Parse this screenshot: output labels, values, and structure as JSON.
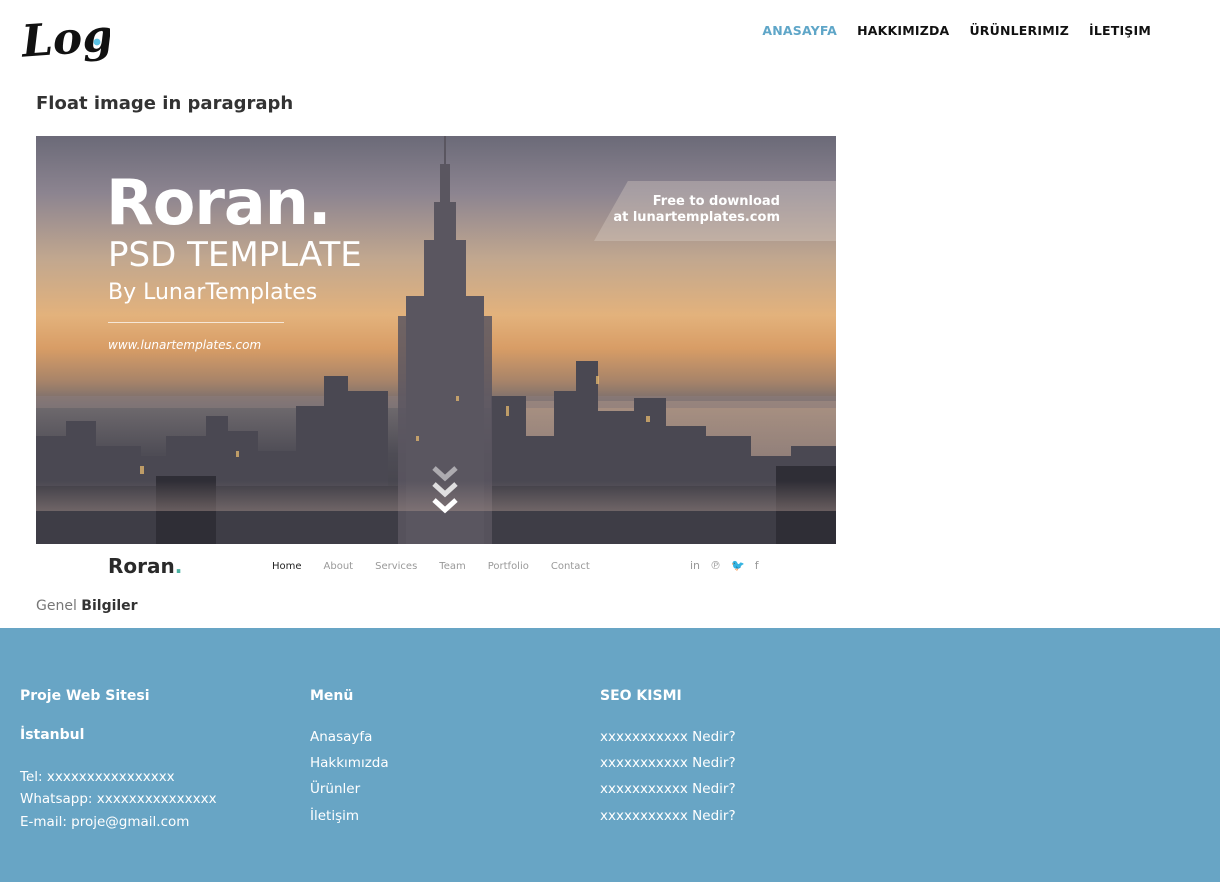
{
  "header": {
    "logo_text": "Logo",
    "nav": [
      {
        "label": "ANASAYFA",
        "active": true
      },
      {
        "label": "HAKKIMIZDA"
      },
      {
        "label": "ÜRÜNLERIMIZ"
      },
      {
        "label": "İLETIŞIM"
      }
    ]
  },
  "main": {
    "title": "Float image in paragraph",
    "hero": {
      "brand": "Roran.",
      "subtitle": "PSD TEMPLATE",
      "by": "By LunarTemplates",
      "url": "www.lunartemplates.com",
      "ribbon_line1": "Free to download",
      "ribbon_line2": "at lunartemplates.com"
    },
    "template_nav": {
      "brand": "Roran",
      "brand_dot": ".",
      "items": [
        "Home",
        "About",
        "Services",
        "Team",
        "Portfolio",
        "Contact"
      ],
      "social": [
        "in",
        "℗",
        "🐦",
        "f"
      ]
    },
    "info_light": "Genel",
    "info_bold": "Bilgiler"
  },
  "footer": {
    "col1": {
      "title": "Proje Web Sitesi",
      "city": "İstanbul",
      "tel": "Tel: xxxxxxxxxxxxxxxx",
      "whatsapp": "Whatsapp: xxxxxxxxxxxxxxx",
      "email": "E-mail: proje@gmail.com"
    },
    "col2": {
      "title": "Menü",
      "links": [
        "Anasayfa",
        "Hakkımızda",
        "Ürünler",
        "İletişim"
      ]
    },
    "col3": {
      "title": "SEO KISMI",
      "links": [
        "xxxxxxxxxxx Nedir?",
        "xxxxxxxxxxx Nedir?",
        "xxxxxxxxxxx Nedir?",
        "xxxxxxxxxxx Nedir?"
      ]
    }
  },
  "colors": {
    "accent": "#5fa6c8",
    "footer_bg": "#68a5c5"
  }
}
